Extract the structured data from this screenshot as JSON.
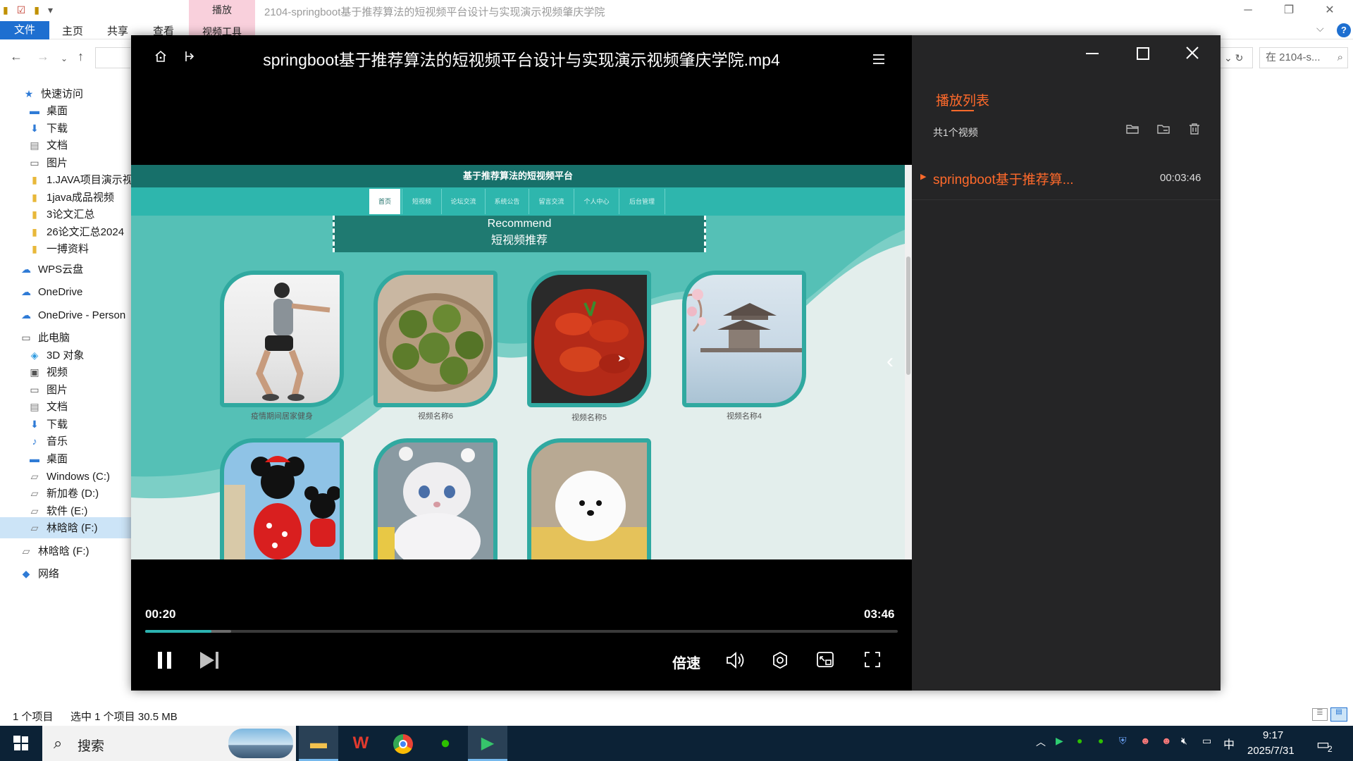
{
  "explorer": {
    "title": "2104-springboot基于推荐算法的短视频平台设计与实现演示视频肇庆学院",
    "ribbon_context_tab": "播放",
    "ribbon_tabs": [
      "文件",
      "主页",
      "共享",
      "查看",
      "视频工具"
    ],
    "search_placeholder": "在 2104-s...",
    "sidebar": [
      {
        "label": "快速访问",
        "icon": "star-icon"
      },
      {
        "label": "桌面",
        "icon": "desktop-icon"
      },
      {
        "label": "下载",
        "icon": "download-icon"
      },
      {
        "label": "文档",
        "icon": "document-icon"
      },
      {
        "label": "图片",
        "icon": "picture-icon"
      },
      {
        "label": "1.JAVA项目演示视",
        "icon": "folder-icon"
      },
      {
        "label": "1java成品视频",
        "icon": "folder-icon"
      },
      {
        "label": "3论文汇总",
        "icon": "folder-icon"
      },
      {
        "label": "26论文汇总2024",
        "icon": "folder-icon"
      },
      {
        "label": "一搏资料",
        "icon": "folder-icon"
      },
      {
        "label": "WPS云盘",
        "icon": "cloud-icon"
      },
      {
        "label": "OneDrive",
        "icon": "cloud-icon"
      },
      {
        "label": "OneDrive - Person",
        "icon": "cloud-icon"
      },
      {
        "label": "此电脑",
        "icon": "computer-icon"
      },
      {
        "label": "3D 对象",
        "icon": "cube-icon"
      },
      {
        "label": "视频",
        "icon": "video-icon"
      },
      {
        "label": "图片",
        "icon": "picture-icon"
      },
      {
        "label": "文档",
        "icon": "document-icon"
      },
      {
        "label": "下载",
        "icon": "download-icon"
      },
      {
        "label": "音乐",
        "icon": "music-icon"
      },
      {
        "label": "桌面",
        "icon": "desktop-icon"
      },
      {
        "label": "Windows  (C:)",
        "icon": "drive-icon"
      },
      {
        "label": "新加卷 (D:)",
        "icon": "drive-icon"
      },
      {
        "label": "软件 (E:)",
        "icon": "drive-icon"
      },
      {
        "label": "林晗晗 (F:)",
        "icon": "drive-icon"
      },
      {
        "label": "林晗晗 (F:)",
        "icon": "drive-icon"
      },
      {
        "label": "网络",
        "icon": "network-icon"
      }
    ],
    "status_items": "1 个项目",
    "status_selected": "选中 1 个项目  30.5 MB"
  },
  "player": {
    "title": "springboot基于推荐算法的短视频平台设计与实现演示视频肇庆学院.mp4",
    "playlist_title": "播放列表",
    "playlist_count": "共1个视频",
    "playlist_items": [
      {
        "name": "springboot基于推荐算...",
        "duration": "00:03:46"
      }
    ],
    "current_time": "00:20",
    "total_time": "03:46",
    "progress_fraction": 0.088,
    "speed_label": "倍速",
    "accent_color": "#ff6a2b",
    "progress_color": "#2bb3b1"
  },
  "video_page": {
    "site_title": "基于推荐算法的短视频平台",
    "nav_tabs": [
      "首页",
      "短视频",
      "论坛交流",
      "系统公告",
      "留言交流",
      "个人中心",
      "后台管理"
    ],
    "recommend_en": "Recommend",
    "recommend_zh": "短视频推荐",
    "cards": [
      {
        "caption": "疫情期间居家健身"
      },
      {
        "caption": "视频名称6"
      },
      {
        "caption": "视频名称5"
      },
      {
        "caption": "视频名称4"
      },
      {
        "caption": ""
      },
      {
        "caption": ""
      },
      {
        "caption": ""
      }
    ]
  },
  "taskbar": {
    "search_label": "搜索",
    "ime_label": "中",
    "time": "9:17",
    "date": "2025/7/31",
    "notification_count": "2"
  }
}
